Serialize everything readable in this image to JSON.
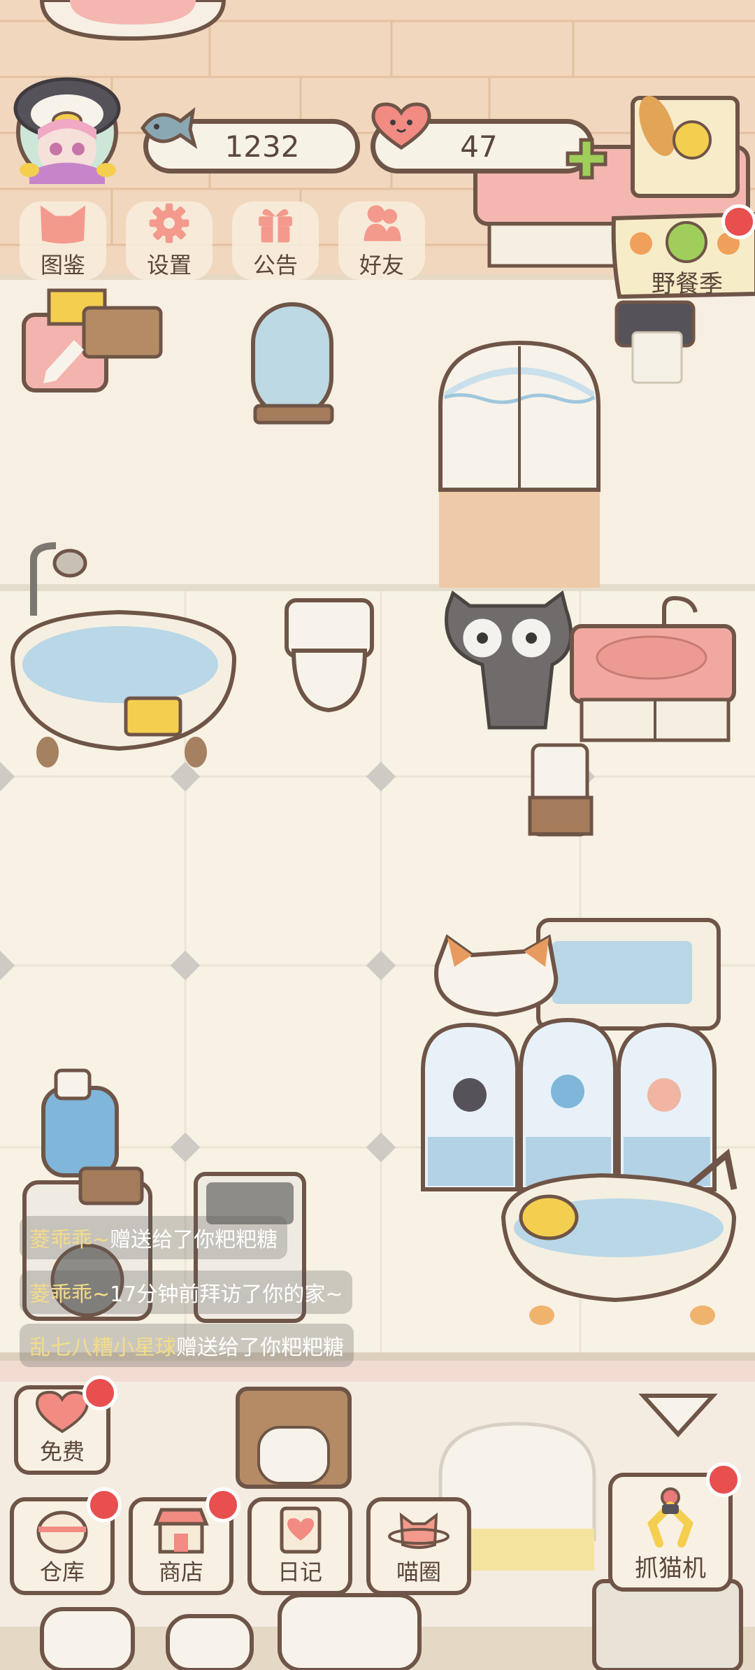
{
  "hud": {
    "fish_count": "1232",
    "heart_count": "47"
  },
  "top_menu": [
    {
      "label": "图鉴",
      "icon": "cat-head-icon"
    },
    {
      "label": "设置",
      "icon": "gear-icon"
    },
    {
      "label": "公告",
      "icon": "gift-icon"
    },
    {
      "label": "好友",
      "icon": "friends-icon"
    }
  ],
  "event_banner": {
    "label": "野餐季"
  },
  "chat_feed": [
    {
      "name": "菱乖乖~",
      "message": "赠送给了你粑粑糖"
    },
    {
      "name": "菱乖乖~",
      "message": "17分钟前拜访了你的家~"
    },
    {
      "name": "乱七八糟小星球",
      "message": "赠送给了你粑粑糖"
    }
  ],
  "bottom_menu": {
    "free": "免费",
    "warehouse": "仓库",
    "shop": "商店",
    "diary": "日记",
    "cat_circle": "喵圈",
    "claw_machine": "抓猫机"
  },
  "colors": {
    "outline": "#6f5547",
    "wall": "#f6efe2",
    "floor": "#f7f2e4",
    "brick": "#efd2b4",
    "accent_red": "#e84f4f",
    "accent_green": "#9fcf5a"
  }
}
